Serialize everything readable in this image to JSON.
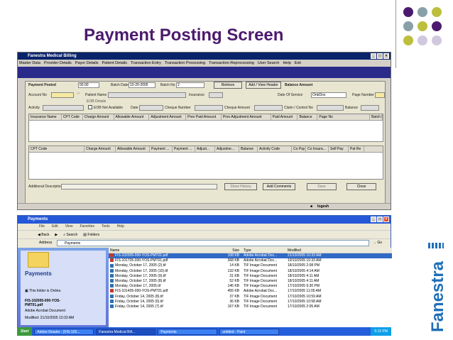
{
  "slide": {
    "title": "Payment Posting Screen",
    "brand": "Fanestra",
    "dot_colors": [
      "#4b1a6e",
      "#8aa0a8",
      "#bcbf3c",
      "#8aa0a8",
      "#bcbf3c",
      "#4b1a6e",
      "#bcbf3c",
      "#d0c8dc",
      "#d0c8dc"
    ]
  },
  "app": {
    "title": "Fanestra Medical Billing",
    "menu": [
      "Master Data",
      "Provider Details",
      "Payor Details",
      "Patient Details",
      "Transaction Entry",
      "Transaction Processing",
      "Transaction Reprocessing",
      "User Search",
      "Help",
      "Exit"
    ],
    "panel_title": "Payment Posted",
    "amount_value": "00.00",
    "batch_date_label": "Batch Date",
    "batch_date_value": "10-20-2005",
    "batch_no_label": "Batch No",
    "batch_no_value": "2",
    "retrieve_button": "Retrieve",
    "add_view_header_button": "Add / View Header",
    "balance_amount_label": "Balance Amount",
    "account_no_label": "Account No",
    "patient_name_label": "Patient Name",
    "insurance_label": "Insurance",
    "date_of_service_label": "Date Of Service",
    "date_of_service_value": "OnbDos",
    "page_number_label": "Page Number",
    "eob_details_label": "EOB Details",
    "activity_label": "Activity",
    "eob_not_available_label": "EOB Not Available",
    "date_label": "Date",
    "cheque_number_label": "Cheque Number",
    "cheque_amount_label": "Cheque Amount",
    "claim_control_label": "Claim / Control No",
    "balance_label": "Balance",
    "grid1_headers": [
      "Insurance Name",
      "CPT Code",
      "Charge Amount",
      "Allowable Amount",
      "Adjustment Amount",
      "Prev Paid Amount",
      "Prev Adjustment Amount",
      "Paid Amount",
      "Balance",
      "Page No",
      "Batch Date"
    ],
    "grid2_headers": [
      "CPT Code",
      "Charge Amount",
      "Allowable Amount",
      "Payment ...",
      "Payment ...",
      "Adjust...",
      "Adjustme...",
      "Balance",
      "Activity Code",
      "Co Pay",
      "Co Insura...",
      "Self Pay",
      "Pat Re"
    ],
    "additional_description_label": "Additional Description",
    "show_history_button": "Show History",
    "add_comments_button": "Add Comments",
    "save_button": "Save",
    "close_button": "Close",
    "status_user": "logesh"
  },
  "explorer": {
    "title": "Payments",
    "menu": [
      "File",
      "Edit",
      "View",
      "Favorites",
      "Tools",
      "Help"
    ],
    "toolbar": [
      "Back",
      "Search",
      "Folders"
    ],
    "address_label": "Address",
    "address_value": "Payments",
    "go_label": "Go",
    "folder_title": "Payments",
    "online_text": "This folder is Online.",
    "selected_file": "FIS-102005-000-YOS-PMT01.pdf",
    "selected_type": "Adobe Acrobat Document",
    "modified_text": "Modified: 21/10/2005 10:33 AM",
    "columns": [
      "Name",
      "Size",
      "Type",
      "Modified"
    ],
    "files": [
      {
        "name": "FIS-102005-000-YOS-PMT01.pdf",
        "size": "108 KB",
        "type": "Adobe Acrobat Doc...",
        "modified": "21/10/2005 10:33 AM",
        "icon": "pdf-icon"
      },
      {
        "name": "FIS-101705-000-YOS-PMT01.pdf",
        "size": "368 KB",
        "type": "Adobe Acrobat Doc...",
        "modified": "19/10/2005 10:33 AM",
        "icon": "pdf-icon"
      },
      {
        "name": "Monday, October 17, 2005 (2).tif",
        "size": "14 KB",
        "type": "TIF Image Document",
        "modified": "18/10/2005 2:08 PM",
        "icon": "tif-icon"
      },
      {
        "name": "Monday, October 17, 2005 (10).tif",
        "size": "132 KB",
        "type": "TIF Image Document",
        "modified": "18/10/2005 4:14 AM",
        "icon": "tif-icon"
      },
      {
        "name": "Monday, October 17, 2005 (9).tif",
        "size": "31 KB",
        "type": "TIF Image Document",
        "modified": "18/10/2005 4:11 AM",
        "icon": "tif-icon"
      },
      {
        "name": "Monday, October 17, 2005 (8).tif",
        "size": "52 KB",
        "type": "TIF Image Document",
        "modified": "18/10/2005 4:11 AM",
        "icon": "tif-icon"
      },
      {
        "name": "Monday, October 17, 2005.tif",
        "size": "146 KB",
        "type": "TIF Image Document",
        "modified": "17/10/2005 9:30 PM",
        "icon": "tif-icon"
      },
      {
        "name": "FIS-101405-000-YOS-PMT01.pdf",
        "size": "455 KB",
        "type": "Adobe Acrobat Doc...",
        "modified": "17/10/2005 11:05 AM",
        "icon": "pdf-icon"
      },
      {
        "name": "Friday, October 14, 2005 (8).tif",
        "size": "37 KB",
        "type": "TIF Image Document",
        "modified": "17/10/2005 10:59 AM",
        "icon": "tif-icon"
      },
      {
        "name": "Friday, October 14, 2005 (6).tif",
        "size": "36 KB",
        "type": "TIF Image Document",
        "modified": "17/10/2005 10:58 AM",
        "icon": "tif-icon"
      },
      {
        "name": "Friday, October 14, 2005 (7).tif",
        "size": "167 KB",
        "type": "TIF Image Document",
        "modified": "17/10/2005 2:05 AM",
        "icon": "tif-icon"
      }
    ]
  },
  "taskbar": {
    "start": "Start",
    "items": [
      "Adobe Reader - [FIS-102...",
      "Fanestra Medical Bill...",
      "Payments",
      "untitled - Paint"
    ],
    "clock": "5:15 PM"
  }
}
